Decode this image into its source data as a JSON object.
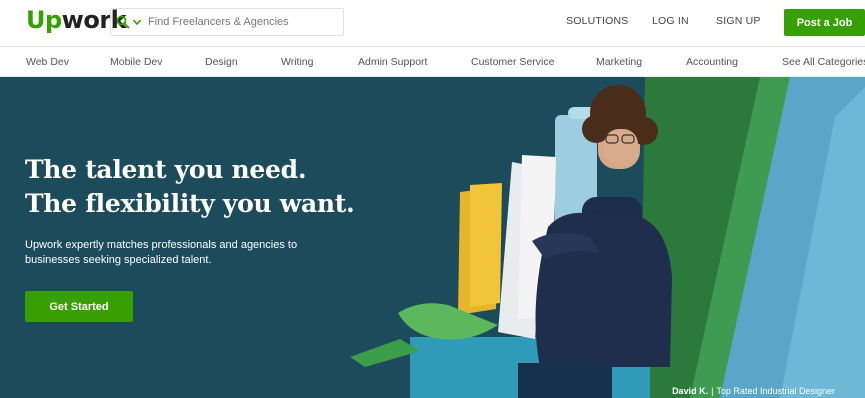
{
  "brand": {
    "logo_up": "Up",
    "logo_work": "work",
    "accent": "#37a000"
  },
  "search": {
    "placeholder": "Find Freelancers & Agencies",
    "icon": "search-icon"
  },
  "header": {
    "solutions": "SOLUTIONS",
    "login": "LOG IN",
    "signup": "SIGN UP",
    "post_job": "Post a Job"
  },
  "categories": [
    "Web Dev",
    "Mobile Dev",
    "Design",
    "Writing",
    "Admin Support",
    "Customer Service",
    "Marketing",
    "Accounting",
    "See All Categories"
  ],
  "hero": {
    "headline_line1": "The talent you need.",
    "headline_line2": "The flexibility you want.",
    "subtext": "Upwork expertly matches professionals and agencies to businesses seeking specialized talent.",
    "cta": "Get Started",
    "caption_name": "David K.",
    "caption_sep": "|",
    "caption_role": "Top Rated Industrial Designer",
    "background": "#1c4b5c"
  }
}
